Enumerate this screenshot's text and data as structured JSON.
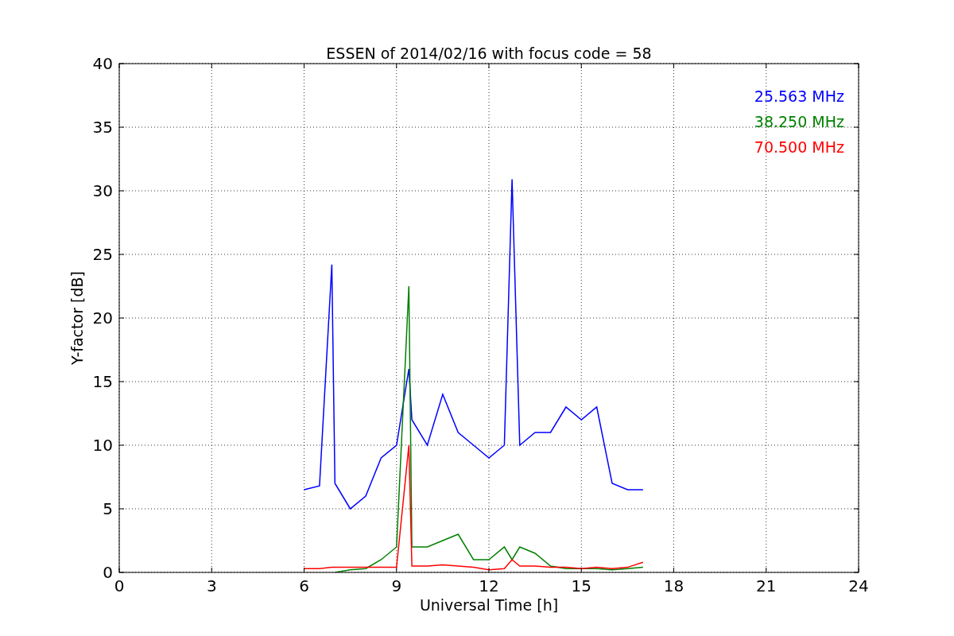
{
  "chart_data": {
    "type": "line",
    "title": "ESSEN of 2014/02/16 with focus code = 58",
    "xlabel": "Universal Time [h]",
    "ylabel": "Y-factor [dB]",
    "x": [
      6,
      6.5,
      6.9,
      7,
      7.5,
      8,
      8.5,
      9,
      9.4,
      9.5,
      10,
      10.5,
      11,
      11.5,
      12,
      12.5,
      12.75,
      13,
      13.5,
      14,
      14.5,
      15,
      15.5,
      16,
      16.5,
      17
    ],
    "series": [
      {
        "name": "25.563 MHz",
        "color": "#0000ff",
        "values": [
          6.5,
          6.8,
          24.2,
          7,
          5,
          6,
          9,
          10,
          16,
          12,
          10,
          14,
          11,
          10,
          9,
          10,
          30.9,
          10,
          11,
          11,
          13,
          12,
          13,
          7,
          6.5,
          6.5
        ]
      },
      {
        "name": "38.250 MHz",
        "color": "#008000",
        "values": [
          null,
          null,
          null,
          0,
          0.2,
          0.3,
          1,
          2,
          22.5,
          2,
          2,
          2.5,
          3,
          1,
          1,
          2,
          1,
          2,
          1.5,
          0.5,
          0.3,
          0.3,
          0.3,
          0.2,
          0.3,
          0.4
        ]
      },
      {
        "name": "70.500 MHz",
        "color": "#ff0000",
        "values": [
          0.3,
          0.3,
          0.4,
          0.4,
          0.4,
          0.4,
          0.4,
          0.4,
          10,
          0.5,
          0.5,
          0.6,
          0.5,
          0.4,
          0.2,
          0.3,
          1,
          0.5,
          0.5,
          0.4,
          0.4,
          0.3,
          0.4,
          0.3,
          0.4,
          0.8
        ]
      }
    ],
    "grid": true,
    "xlim": [
      0,
      24
    ],
    "ylim": [
      0,
      40
    ],
    "xticks": [
      0,
      3,
      6,
      9,
      12,
      15,
      18,
      21,
      24
    ],
    "yticks": [
      0,
      5,
      10,
      15,
      20,
      25,
      30,
      35,
      40
    ]
  }
}
